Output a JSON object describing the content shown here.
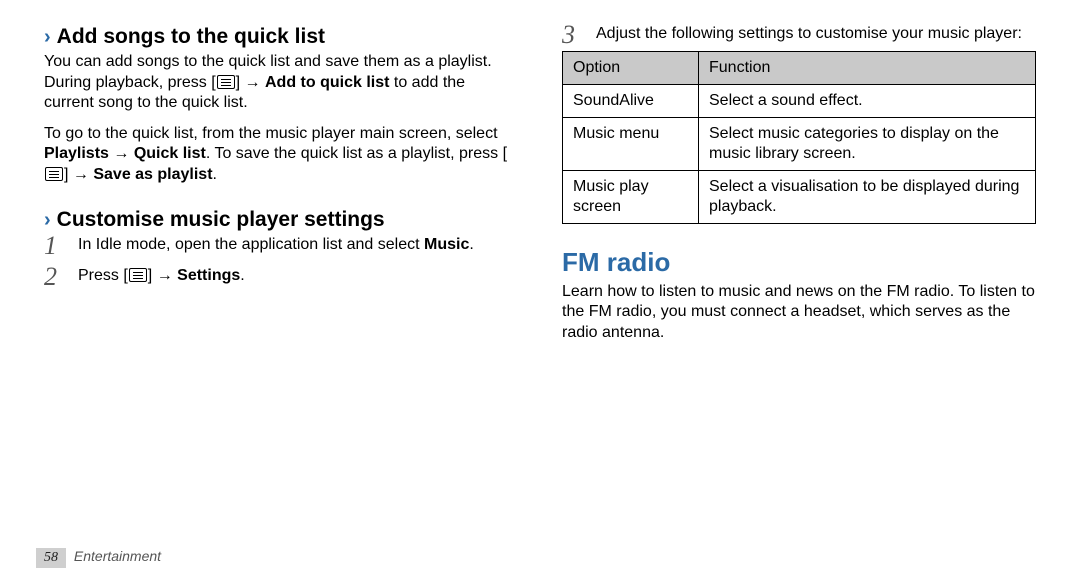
{
  "left": {
    "h_addsongs": "Add songs to the quick list",
    "p_addsongs_1a": "You can add songs to the quick list and save them as a playlist. During playback, press [",
    "p_addsongs_1b": "] → ",
    "p_addsongs_bold1": "Add to quick list",
    "p_addsongs_1c": " to add the current song to the quick list.",
    "p_addsongs_2a": "To go to the quick list, from the music player main screen, select ",
    "p_addsongs_bold2": "Playlists",
    "p_addsongs_2b": " → ",
    "p_addsongs_bold3": "Quick list",
    "p_addsongs_2c": ". To save the quick list as a playlist, press [",
    "p_addsongs_2d": "] → ",
    "p_addsongs_bold4": "Save as playlist",
    "p_addsongs_2e": ".",
    "h_custom": "Customise music player settings",
    "step1a": "In Idle mode, open the application list and select ",
    "step1bold": "Music",
    "step1b": ".",
    "step2a": "Press [",
    "step2b": "] → ",
    "step2bold": "Settings",
    "step2c": "."
  },
  "right": {
    "step3": "Adjust the following settings to customise your music player:",
    "table": {
      "head_option": "Option",
      "head_function": "Function",
      "rows": [
        {
          "option": "SoundAlive",
          "function": "Select a sound effect."
        },
        {
          "option": "Music menu",
          "function": "Select music categories to display on the music library screen."
        },
        {
          "option": "Music play screen",
          "function": "Select a visualisation to be displayed during playback."
        }
      ]
    },
    "h_fm": "FM radio",
    "p_fm": "Learn how to listen to music and news on the FM radio. To listen to the FM radio, you must connect a headset, which serves as the radio antenna."
  },
  "footer": {
    "page": "58",
    "section": "Entertainment"
  }
}
